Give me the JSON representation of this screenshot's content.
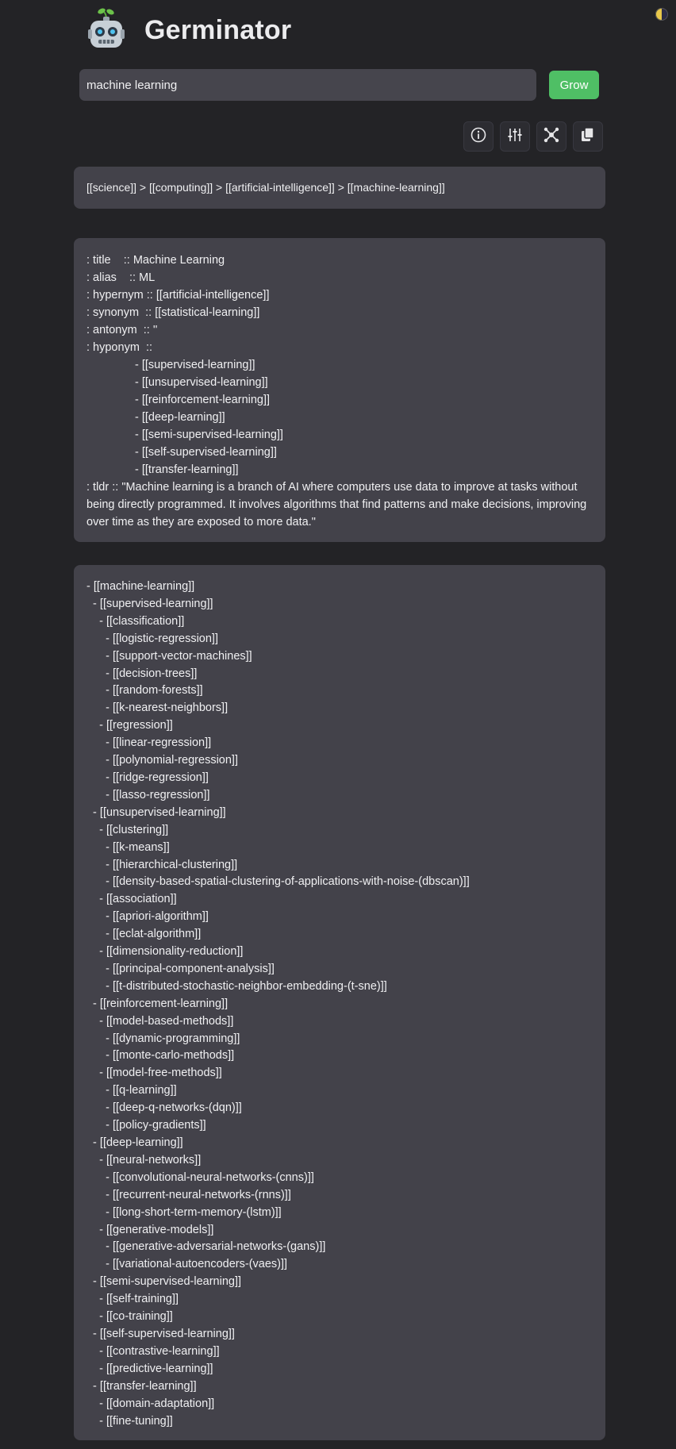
{
  "app": {
    "title": "Germinator",
    "logo": "robot-seedling-logo"
  },
  "theme_toggle": {
    "icon": "half-moon-icon"
  },
  "search": {
    "value": "machine learning",
    "placeholder": ""
  },
  "grow_button": {
    "label": "Grow",
    "color": "#4fbf65"
  },
  "toolbar": {
    "icons": [
      "info-icon",
      "sliders-icon",
      "graph-icon",
      "copy-icon"
    ]
  },
  "breadcrumb": {
    "text": "[[science]] > [[computing]] > [[artificial-intelligence]] > [[machine-learning]]"
  },
  "metadata": {
    "title": ": title    :: Machine Learning",
    "alias": ": alias    :: ML",
    "hypernym": ": hypernym :: [[artificial-intelligence]]",
    "synonym": ": synonym  :: [[statistical-learning]]",
    "antonym": ": antonym  :: ''",
    "hyponym": ": hyponym  ::",
    "hyponyms": [
      "- [[supervised-learning]]",
      "- [[unsupervised-learning]]",
      "- [[reinforcement-learning]]",
      "- [[deep-learning]]",
      "- [[semi-supervised-learning]]",
      "- [[self-supervised-learning]]",
      "- [[transfer-learning]]"
    ],
    "tldr": ": tldr    :: \"Machine learning is a branch of AI where computers use data to improve at tasks without being directly programmed. It involves algorithms that find patterns and make decisions, improving over time as they are exposed to more data.\""
  },
  "tree": [
    "- [[machine-learning]]",
    "  - [[supervised-learning]]",
    "    - [[classification]]",
    "      - [[logistic-regression]]",
    "      - [[support-vector-machines]]",
    "      - [[decision-trees]]",
    "      - [[random-forests]]",
    "      - [[k-nearest-neighbors]]",
    "    - [[regression]]",
    "      - [[linear-regression]]",
    "      - [[polynomial-regression]]",
    "      - [[ridge-regression]]",
    "      - [[lasso-regression]]",
    "  - [[unsupervised-learning]]",
    "    - [[clustering]]",
    "      - [[k-means]]",
    "      - [[hierarchical-clustering]]",
    "      - [[density-based-spatial-clustering-of-applications-with-noise-(dbscan)]]",
    "    - [[association]]",
    "      - [[apriori-algorithm]]",
    "      - [[eclat-algorithm]]",
    "    - [[dimensionality-reduction]]",
    "      - [[principal-component-analysis]]",
    "      - [[t-distributed-stochastic-neighbor-embedding-(t-sne)]]",
    "  - [[reinforcement-learning]]",
    "    - [[model-based-methods]]",
    "      - [[dynamic-programming]]",
    "      - [[monte-carlo-methods]]",
    "    - [[model-free-methods]]",
    "      - [[q-learning]]",
    "      - [[deep-q-networks-(dqn)]]",
    "      - [[policy-gradients]]",
    "  - [[deep-learning]]",
    "    - [[neural-networks]]",
    "      - [[convolutional-neural-networks-(cnns)]]",
    "      - [[recurrent-neural-networks-(rnns)]]",
    "      - [[long-short-term-memory-(lstm)]]",
    "    - [[generative-models]]",
    "      - [[generative-adversarial-networks-(gans)]]",
    "      - [[variational-autoencoders-(vaes)]]",
    "  - [[semi-supervised-learning]]",
    "    - [[self-training]]",
    "    - [[co-training]]",
    "  - [[self-supervised-learning]]",
    "    - [[contrastive-learning]]",
    "    - [[predictive-learning]]",
    "  - [[transfer-learning]]",
    "    - [[domain-adaptation]]",
    "    - [[fine-tuning]]"
  ]
}
